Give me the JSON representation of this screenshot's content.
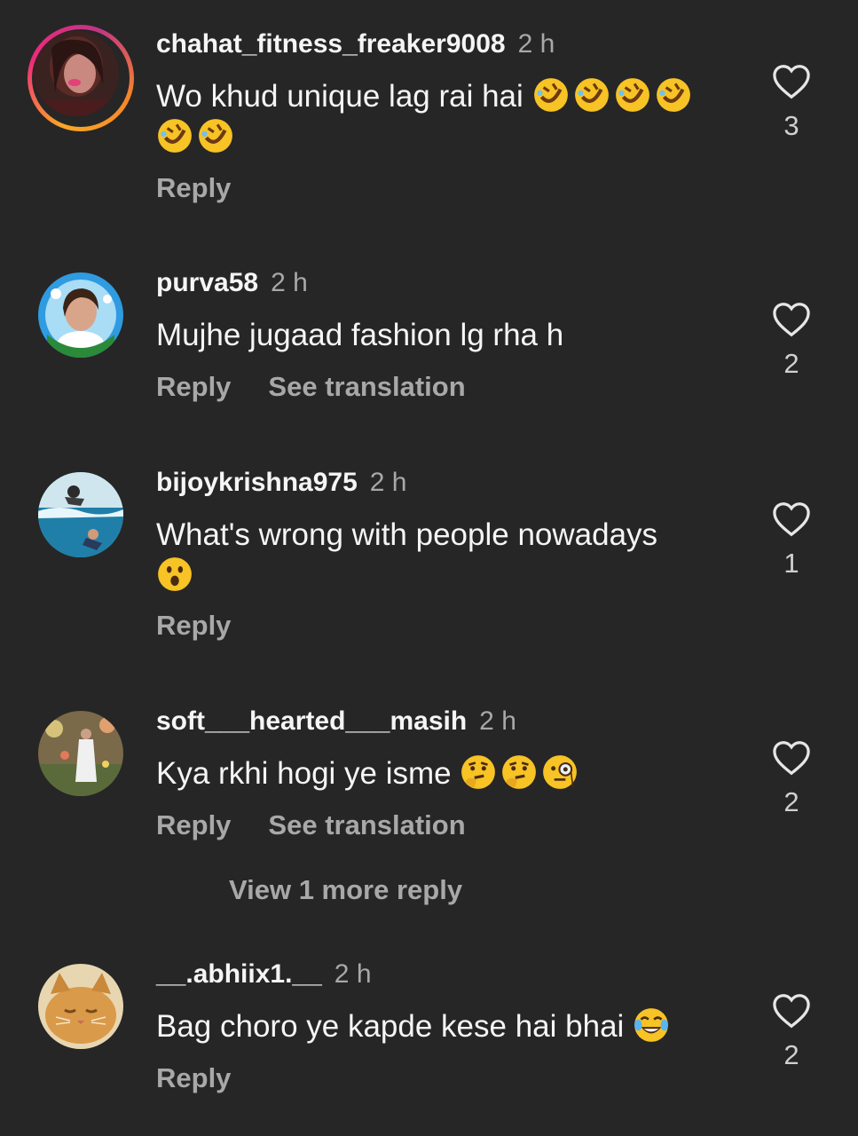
{
  "comments": [
    {
      "username": "chahat_fitness_freaker9008",
      "time": "2 h",
      "text_line1": "Wo khud unique lag rai hai",
      "emoji_line1": [
        "rofl",
        "rofl",
        "rofl",
        "rofl"
      ],
      "emoji_line2": [
        "rofl",
        "rofl"
      ],
      "reply_label": "Reply",
      "likes": "3"
    },
    {
      "username": "purva58",
      "time": "2 h",
      "text": "Mujhe jugaad fashion lg rha h",
      "reply_label": "Reply",
      "translate_label": "See translation",
      "likes": "2"
    },
    {
      "username": "bijoykrishna975",
      "time": "2 h",
      "text": "What's wrong with people nowadays",
      "emoji_line2": [
        "hushed-face"
      ],
      "reply_label": "Reply",
      "likes": "1"
    },
    {
      "username": "soft___hearted___masih",
      "time": "2 h",
      "text": "Kya rkhi hogi ye isme",
      "emoji_line1": [
        "thinking-face",
        "thinking-face",
        "monocle-face"
      ],
      "reply_label": "Reply",
      "translate_label": "See translation",
      "likes": "2"
    },
    {
      "username": "__.abhiix1.__",
      "time": "2 h",
      "text": "Bag choro ye kapde kese hai bhai",
      "emoji_line1": [
        "tears-of-joy"
      ],
      "reply_label": "Reply",
      "likes": "2"
    }
  ],
  "view_more_replies": "View 1 more reply",
  "colors": {
    "background": "#262626",
    "primary_text": "#f5f5f5",
    "secondary_text": "#a8a8a8",
    "emoji_yellow": "#f7c325"
  }
}
